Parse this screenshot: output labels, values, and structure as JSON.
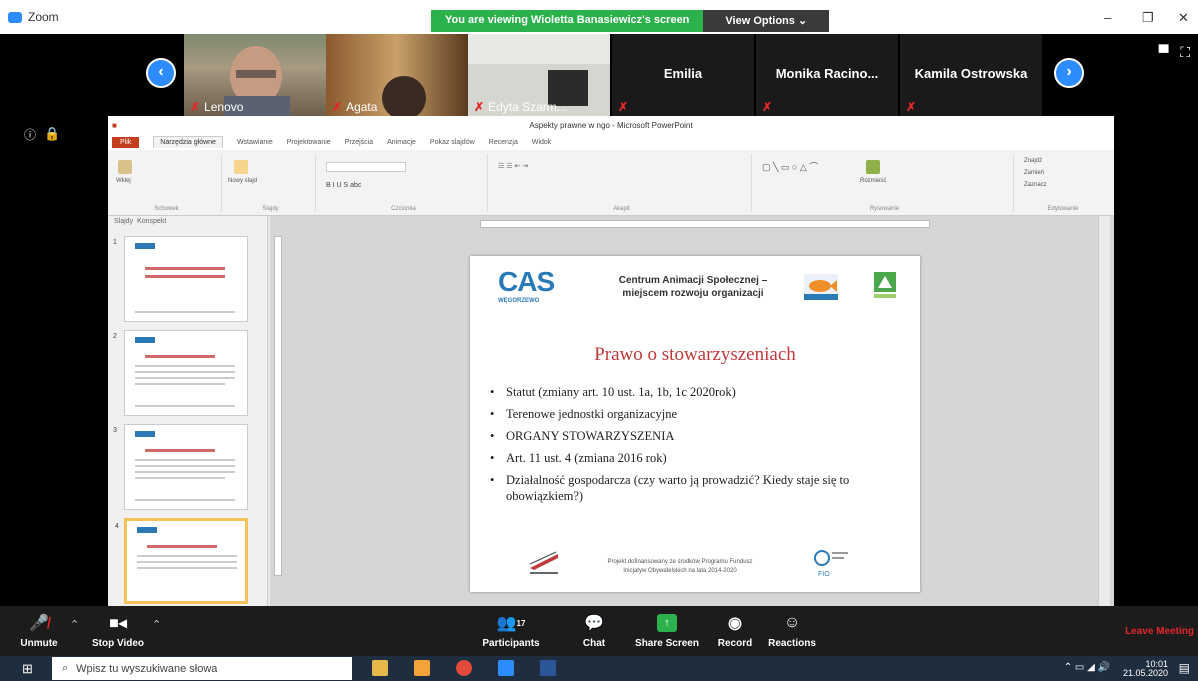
{
  "window": {
    "app_name": "Zoom",
    "banner_text": "You are viewing Wioletta Banasiewicz's screen",
    "view_options_label": "View Options ⌄",
    "minimize": "–",
    "restore": "❐",
    "close": "✕"
  },
  "participants_strip": {
    "tiles": [
      {
        "name": "Lenovo"
      },
      {
        "name": "Agata"
      },
      {
        "name": "Edyta Szarm..."
      },
      {
        "name": "",
        "big_name": "Emilia"
      },
      {
        "name": "",
        "big_name": "Monika Racino..."
      },
      {
        "name": "",
        "big_name": "Kamila Ostrowska"
      }
    ],
    "prev_label": "‹",
    "next_label": "›"
  },
  "powerpoint": {
    "title": "Aspekty prawne w ngo - Microsoft PowerPoint",
    "tabs": [
      "Plik",
      "Narzędzia główne",
      "Wstawianie",
      "Projektowanie",
      "Przejścia",
      "Animacje",
      "Pokaz slajdów",
      "Recenzja",
      "Widok"
    ],
    "ribbon_groups": [
      "Schowek",
      "Slajdy",
      "Czcionka",
      "Akapit",
      "Rysowanie",
      "Edytowanie"
    ],
    "ribbon_items": {
      "paste": "Wklej",
      "new_slide": "Nowy slajd",
      "find": "Znajdź",
      "replace": "Zamień",
      "select": "Zaznacz",
      "arrange": "Rozmieść"
    },
    "thumb_tabs": [
      "Slajdy",
      "Konspekt"
    ],
    "thumb_numbers": [
      "1",
      "2",
      "3",
      "4"
    ],
    "slide": {
      "logo_text": "CAS",
      "logo_sub": "WĘGORZEWO",
      "header": "Centrum Animacji Społecznej – miejscem rozwoju organizacji",
      "title": "Prawo o stowarzyszeniach",
      "bullets": [
        "Statut (zmiany art. 10 ust. 1a, 1b, 1c 2020rok)",
        "Terenowe jednostki organizacyjne",
        "ORGANY STOWARZYSZENIA",
        "Art. 11 ust. 4 (zmiana 2016 rok)",
        "Działalność gospodarcza (czy warto ją prowadzić? Kiedy staje się to obowiązkiem?)"
      ],
      "footer": "Projekt dofinansowany ze środków Programu Fundusz Inicjatyw Obywatelskich na lata 2014-2020",
      "footer_logo_text": "FIO"
    }
  },
  "controls": {
    "unmute": "Unmute",
    "stop_video": "Stop Video",
    "participants": "Participants",
    "participants_count": "17",
    "chat": "Chat",
    "share_screen": "Share Screen",
    "record": "Record",
    "reactions": "Reactions",
    "leave": "Leave Meeting"
  },
  "taskbar": {
    "search_placeholder": "Wpisz tu wyszukiwane słowa",
    "time": "10:01",
    "date": "21.05.2020"
  }
}
